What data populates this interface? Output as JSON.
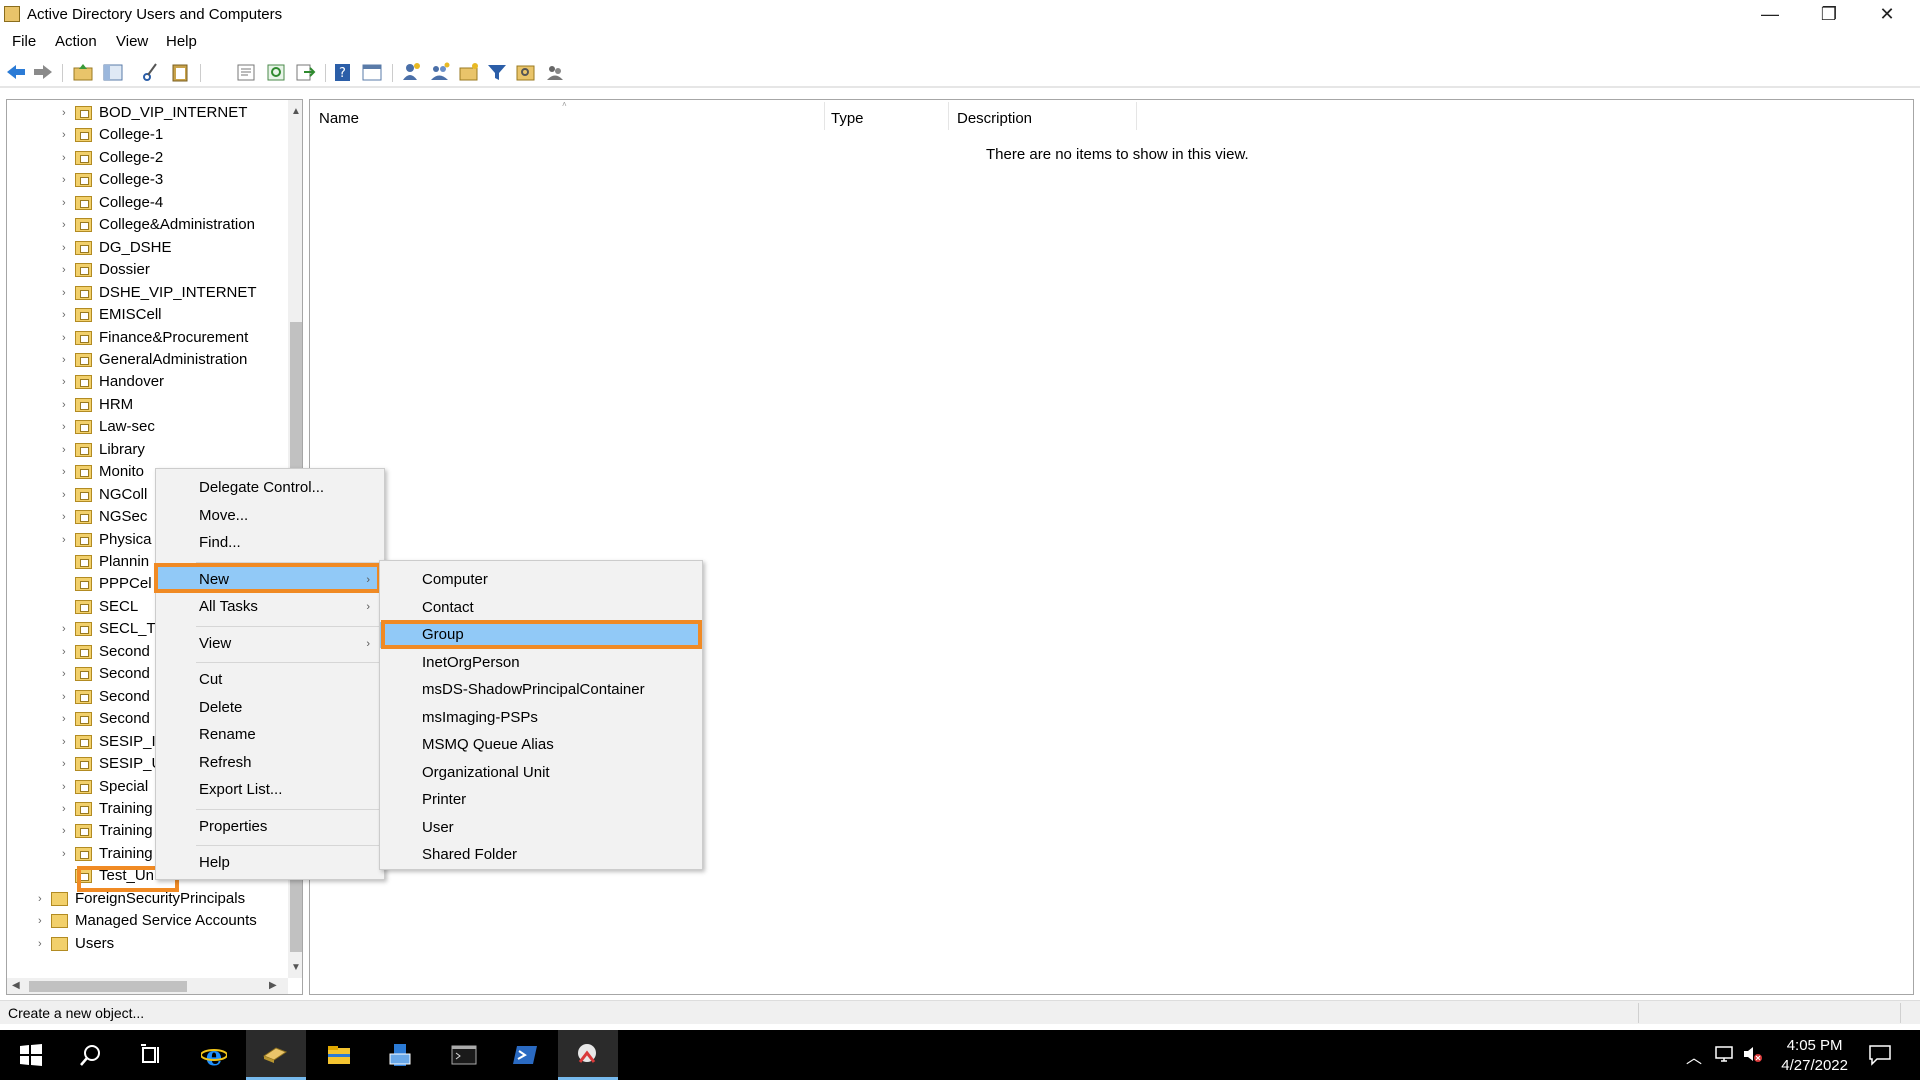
{
  "window": {
    "title": "Active Directory Users and Computers",
    "minimize": "—",
    "restore": "❐",
    "close": "✕"
  },
  "menubar": [
    "File",
    "Action",
    "View",
    "Help"
  ],
  "tree": {
    "items": [
      {
        "label": "BOD_VIP_INTERNET",
        "level": 2,
        "expandable": true
      },
      {
        "label": "College-1",
        "level": 2,
        "expandable": true
      },
      {
        "label": "College-2",
        "level": 2,
        "expandable": true
      },
      {
        "label": "College-3",
        "level": 2,
        "expandable": true
      },
      {
        "label": "College-4",
        "level": 2,
        "expandable": true
      },
      {
        "label": "College&Administration",
        "level": 2,
        "expandable": true
      },
      {
        "label": "DG_DSHE",
        "level": 2,
        "expandable": true
      },
      {
        "label": "Dossier",
        "level": 2,
        "expandable": true
      },
      {
        "label": "DSHE_VIP_INTERNET",
        "level": 2,
        "expandable": true
      },
      {
        "label": "EMISCell",
        "level": 2,
        "expandable": true
      },
      {
        "label": "Finance&Procurement",
        "level": 2,
        "expandable": true
      },
      {
        "label": "GeneralAdministration",
        "level": 2,
        "expandable": true
      },
      {
        "label": "Handover",
        "level": 2,
        "expandable": true
      },
      {
        "label": "HRM",
        "level": 2,
        "expandable": true
      },
      {
        "label": "Law-sec",
        "level": 2,
        "expandable": true
      },
      {
        "label": "Library",
        "level": 2,
        "expandable": true
      },
      {
        "label": "Monito",
        "level": 2,
        "expandable": true
      },
      {
        "label": "NGColl",
        "level": 2,
        "expandable": true
      },
      {
        "label": "NGSec",
        "level": 2,
        "expandable": true
      },
      {
        "label": "Physica",
        "level": 2,
        "expandable": true
      },
      {
        "label": "Plannin",
        "level": 2,
        "expandable": false
      },
      {
        "label": "PPPCel",
        "level": 2,
        "expandable": false
      },
      {
        "label": "SECL",
        "level": 2,
        "expandable": false
      },
      {
        "label": "SECL_TI",
        "level": 2,
        "expandable": true
      },
      {
        "label": "Second",
        "level": 2,
        "expandable": true
      },
      {
        "label": "Second",
        "level": 2,
        "expandable": true
      },
      {
        "label": "Second",
        "level": 2,
        "expandable": true
      },
      {
        "label": "Second",
        "level": 2,
        "expandable": true
      },
      {
        "label": "SESIP_II",
        "level": 2,
        "expandable": true
      },
      {
        "label": "SESIP_U",
        "level": 2,
        "expandable": true
      },
      {
        "label": "Special",
        "level": 2,
        "expandable": true
      },
      {
        "label": "Training",
        "level": 2,
        "expandable": true
      },
      {
        "label": "Training",
        "level": 2,
        "expandable": true
      },
      {
        "label": "Training",
        "level": 2,
        "expandable": true
      },
      {
        "label": "Test_Unit",
        "level": 2,
        "expandable": false,
        "selected": true
      },
      {
        "label": "ForeignSecurityPrincipals",
        "level": 1,
        "expandable": true,
        "plain": true
      },
      {
        "label": "Managed Service Accounts",
        "level": 1,
        "expandable": true,
        "plain": true
      },
      {
        "label": "Users",
        "level": 1,
        "expandable": true,
        "plain": true
      }
    ]
  },
  "list": {
    "columns": [
      "Name",
      "Type",
      "Description"
    ],
    "empty_message": "There are no items to show in this view."
  },
  "context_menu": {
    "items": [
      {
        "label": "Delegate Control...",
        "submenu": false
      },
      {
        "label": "Move...",
        "submenu": false
      },
      {
        "label": "Find...",
        "submenu": false
      },
      {
        "separator": true
      },
      {
        "label": "New",
        "submenu": true,
        "highlighted": true
      },
      {
        "label": "All Tasks",
        "submenu": true
      },
      {
        "separator": true
      },
      {
        "label": "View",
        "submenu": true
      },
      {
        "separator": true
      },
      {
        "label": "Cut",
        "submenu": false
      },
      {
        "label": "Delete",
        "submenu": false
      },
      {
        "label": "Rename",
        "submenu": false
      },
      {
        "label": "Refresh",
        "submenu": false
      },
      {
        "label": "Export List...",
        "submenu": false
      },
      {
        "separator": true
      },
      {
        "label": "Properties",
        "submenu": false
      },
      {
        "separator": true
      },
      {
        "label": "Help",
        "submenu": false
      }
    ]
  },
  "submenu": {
    "items": [
      {
        "label": "Computer"
      },
      {
        "label": "Contact"
      },
      {
        "label": "Group",
        "highlighted": true
      },
      {
        "label": "InetOrgPerson"
      },
      {
        "label": "msDS-ShadowPrincipalContainer"
      },
      {
        "label": "msImaging-PSPs"
      },
      {
        "label": "MSMQ Queue Alias"
      },
      {
        "label": "Organizational Unit"
      },
      {
        "label": "Printer"
      },
      {
        "label": "User"
      },
      {
        "label": "Shared Folder"
      }
    ]
  },
  "statusbar": {
    "text": "Create a new object..."
  },
  "taskbar": {
    "time": "4:05 PM",
    "date": "4/27/2022",
    "apps": [
      "start-icon",
      "search-icon",
      "task-view-icon",
      "internet-explorer-icon",
      "ad-users-computers-icon",
      "file-explorer-icon",
      "server-manager-icon",
      "command-prompt-icon",
      "powershell-icon",
      "snipping-tool-icon"
    ]
  },
  "colors": {
    "highlight": "#91c9f7",
    "annotation_box": "#f08a24",
    "folder": "#f2d06b",
    "taskbar": "#000000"
  }
}
